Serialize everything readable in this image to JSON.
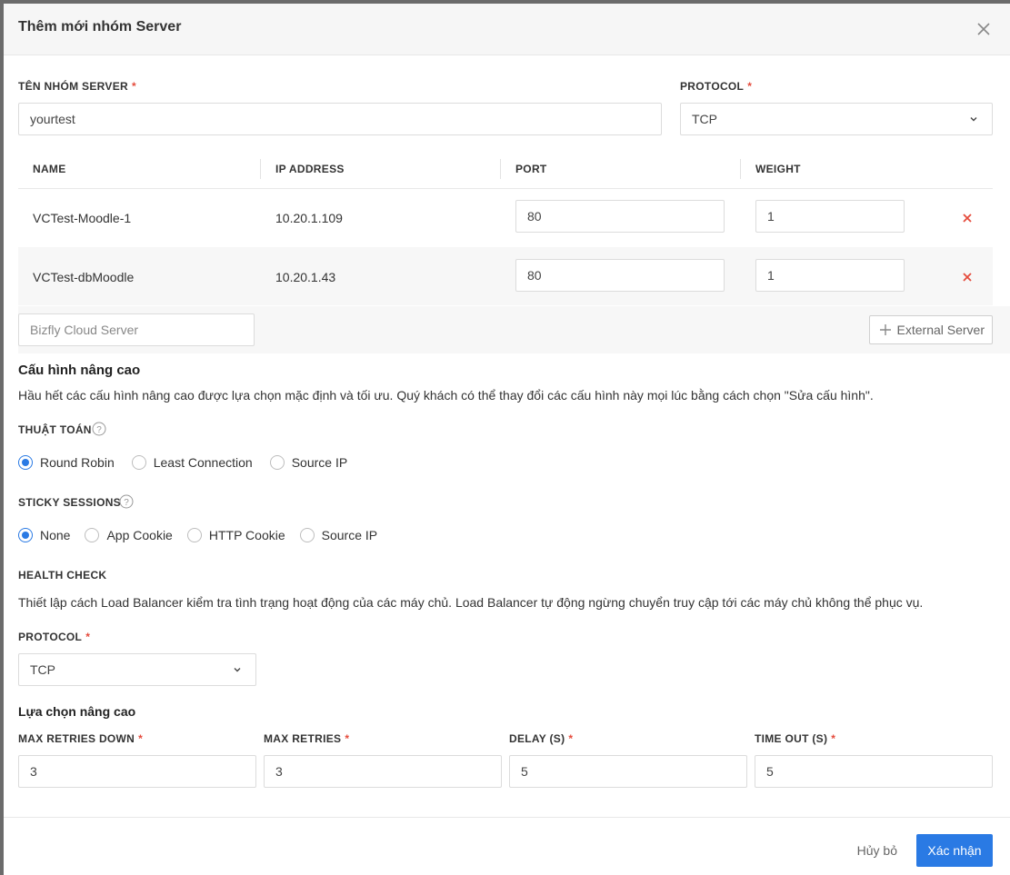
{
  "modal": {
    "title": "Thêm mới nhóm Server"
  },
  "group": {
    "name_label": "TÊN NHÓM SERVER",
    "name_value": "yourtest",
    "protocol_label": "PROTOCOL",
    "protocol_value": "TCP"
  },
  "table": {
    "headers": [
      "NAME",
      "IP ADDRESS",
      "PORT",
      "WEIGHT"
    ],
    "rows": [
      {
        "name": "VCTest-Moodle-1",
        "ip": "10.20.1.109",
        "port": "80",
        "weight": "1"
      },
      {
        "name": "VCTest-dbMoodle",
        "ip": "10.20.1.43",
        "port": "80",
        "weight": "1"
      }
    ]
  },
  "add": {
    "placeholder": "Bizfly Cloud Server",
    "external_label": "External Server"
  },
  "advanced": {
    "title": "Cấu hình nâng cao",
    "desc": "Hầu hết các cấu hình nâng cao được lựa chọn mặc định và tối ưu. Quý khách có thể thay đổi các cấu hình này mọi lúc bằng cách chọn \"Sửa cấu hình\".",
    "algorithm_label": "THUẬT TOÁN",
    "algorithm_options": [
      "Round Robin",
      "Least Connection",
      "Source IP"
    ],
    "algorithm_selected": "Round Robin",
    "sticky_label": "STICKY SESSIONS",
    "sticky_options": [
      "None",
      "App Cookie",
      "HTTP Cookie",
      "Source IP"
    ],
    "sticky_selected": "None"
  },
  "health": {
    "title": "HEALTH CHECK",
    "desc": "Thiết lập cách Load Balancer kiểm tra tình trạng hoạt động của các máy chủ. Load Balancer tự động ngừng chuyển truy cập tới các máy chủ không thể phục vụ.",
    "protocol_label": "PROTOCOL",
    "protocol_value": "TCP",
    "options_title": "Lựa chọn nâng cao",
    "fields": [
      {
        "label": "MAX RETRIES DOWN",
        "value": "3"
      },
      {
        "label": "MAX RETRIES",
        "value": "3"
      },
      {
        "label": "DELAY (S)",
        "value": "5"
      },
      {
        "label": "TIME OUT (S)",
        "value": "5"
      }
    ]
  },
  "footer": {
    "cancel": "Hủy bỏ",
    "confirm": "Xác nhận"
  },
  "colors": {
    "primary": "#2a7ae4",
    "danger": "#e54b3c"
  },
  "icons": {
    "close": "close-icon",
    "remove": "remove-x-icon",
    "plus": "plus-icon",
    "help": "help-circle-icon",
    "chevron": "chevron-down-icon"
  }
}
